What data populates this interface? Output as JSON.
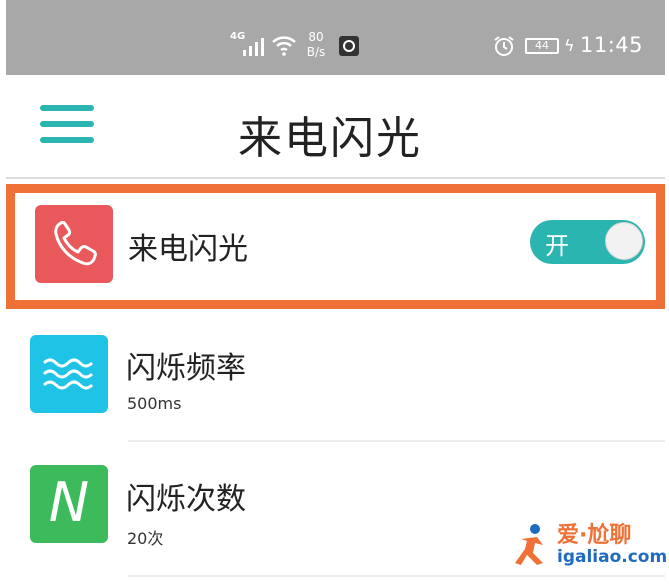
{
  "status_bar": {
    "network": "4G",
    "speed_value": "80",
    "speed_unit": "B/s",
    "battery": "44",
    "time": "11:45"
  },
  "header": {
    "title": "来电闪光"
  },
  "list": [
    {
      "label": "来电闪光",
      "icon": "phone-icon",
      "toggle": {
        "label": "开",
        "on": true
      }
    },
    {
      "label": "闪烁频率",
      "sub": "500ms",
      "icon": "wave-icon"
    },
    {
      "label": "闪烁次数",
      "sub": "20次",
      "icon": "letter-n-icon",
      "icon_text": "N"
    }
  ],
  "watermark": {
    "title": "爱·尬聊",
    "url": "igaliao.com"
  },
  "colors": {
    "accent": "#2bb5b0",
    "highlight": "#f07137",
    "phone_tile": "#e9595c",
    "wave_tile": "#1fc3e6",
    "n_tile": "#3dbb5c"
  }
}
